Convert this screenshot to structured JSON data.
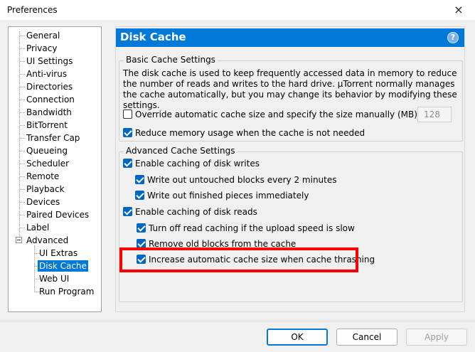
{
  "window": {
    "title": "Preferences",
    "close_icon": "×"
  },
  "tree": {
    "items": [
      "General",
      "Privacy",
      "UI Settings",
      "Anti-virus",
      "Directories",
      "Connection",
      "Bandwidth",
      "BitTorrent",
      "Transfer Cap",
      "Queueing",
      "Scheduler",
      "Remote",
      "Playback",
      "Devices",
      "Paired Devices",
      "Label",
      "Advanced"
    ],
    "sub_items": [
      "UI Extras",
      "Disk Cache",
      "Web UI",
      "Run Program"
    ],
    "selected": "Disk Cache"
  },
  "panel": {
    "title": "Disk Cache",
    "help_icon": "?",
    "basic": {
      "label": "Basic Cache Settings",
      "description": "The disk cache is used to keep frequently accessed data in memory to reduce the number of reads and writes to the hard drive. µTorrent normally manages the cache automatically, but you may change its behavior by modifying these settings.",
      "override": {
        "label": "Override automatic cache size and specify the size manually (MB):",
        "checked": false
      },
      "size_value": "128",
      "reduce": {
        "label": "Reduce memory usage when the cache is not needed",
        "checked": true
      }
    },
    "advanced": {
      "label": "Advanced Cache Settings",
      "enable_writes": {
        "label": "Enable caching of disk writes",
        "checked": true
      },
      "write_untouched": {
        "label": "Write out untouched blocks every 2 minutes",
        "checked": true
      },
      "write_finished": {
        "label": "Write out finished pieces immediately",
        "checked": true
      },
      "enable_reads": {
        "label": "Enable caching of disk reads",
        "checked": true
      },
      "turn_off_read": {
        "label": "Turn off read caching if the upload speed is slow",
        "checked": true
      },
      "remove_old": {
        "label": "Remove old blocks from the cache",
        "checked": true
      },
      "increase_auto": {
        "label": "Increase automatic cache size when cache thrashing",
        "checked": true
      }
    }
  },
  "footer": {
    "ok": "OK",
    "cancel": "Cancel",
    "apply": "Apply"
  },
  "colors": {
    "accent": "#0078d7",
    "highlight": "#ff0000"
  }
}
